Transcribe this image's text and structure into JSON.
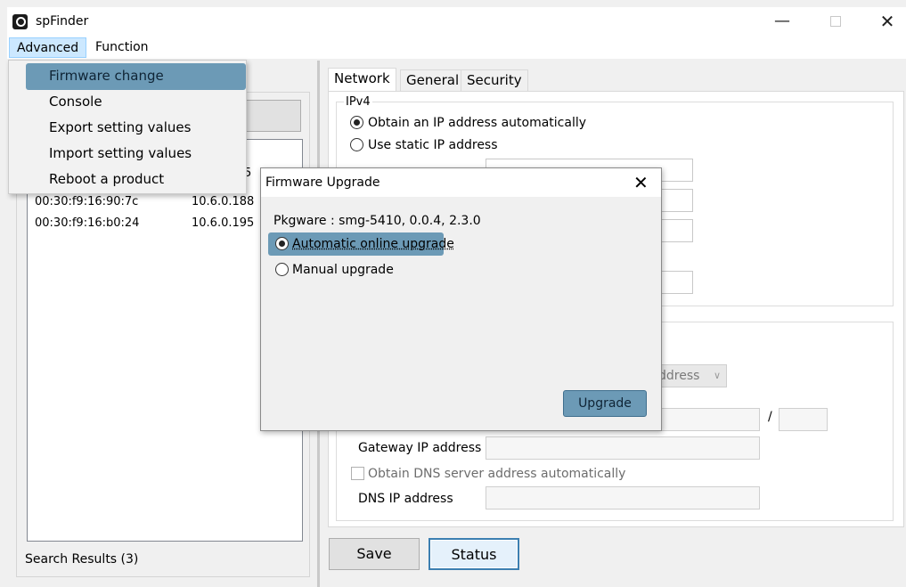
{
  "window": {
    "title": "spFinder",
    "controls": {
      "minimize": "—",
      "maximize": "□",
      "close": "✕"
    }
  },
  "menubar": {
    "items": [
      "Advanced",
      "Function"
    ]
  },
  "advanced_menu": {
    "items": [
      "Firmware change",
      "Console",
      "Export setting values",
      "Import setting values",
      "Reboot a product"
    ],
    "highlighted": "Firmware change"
  },
  "device_list": {
    "rows": [
      {
        "mac": "00:30:f9:16:90:7c",
        "ip": "10.6.0.188"
      },
      {
        "mac": "00:30:f9:16:b0:24",
        "ip": "10.6.0.195"
      }
    ],
    "partial_text": "5",
    "results_label": "Search Results (3)"
  },
  "tabs": [
    "Network",
    "General",
    "Security"
  ],
  "network": {
    "ipv4_label": "IPv4",
    "obtain_auto_label": "Obtain an IP address automatically",
    "use_static_label": "Use static IP address",
    "selected_mode": "Obtain an IP address automatically",
    "ipv6_select_partial": "ddress",
    "prefix_separator": "/",
    "gateway_label": "Gateway IP address",
    "dns_auto_label": "Obtain DNS server address automatically",
    "dns_ip_label": "DNS IP address"
  },
  "buttons": {
    "save": "Save",
    "status": "Status"
  },
  "firmware_dialog": {
    "title": "Firmware Upgrade",
    "close": "✕",
    "pkgware": "Pkgware : smg-5410, 0.0.4, 2.3.0",
    "options": [
      "Automatic online upgrade",
      "Manual upgrade"
    ],
    "selected_option": "Automatic online upgrade",
    "upgrade_button": "Upgrade"
  },
  "colors": {
    "highlight": "#6c9ab6",
    "menu_selected": "#cce8ff",
    "focus_border": "#3c7fb1"
  }
}
